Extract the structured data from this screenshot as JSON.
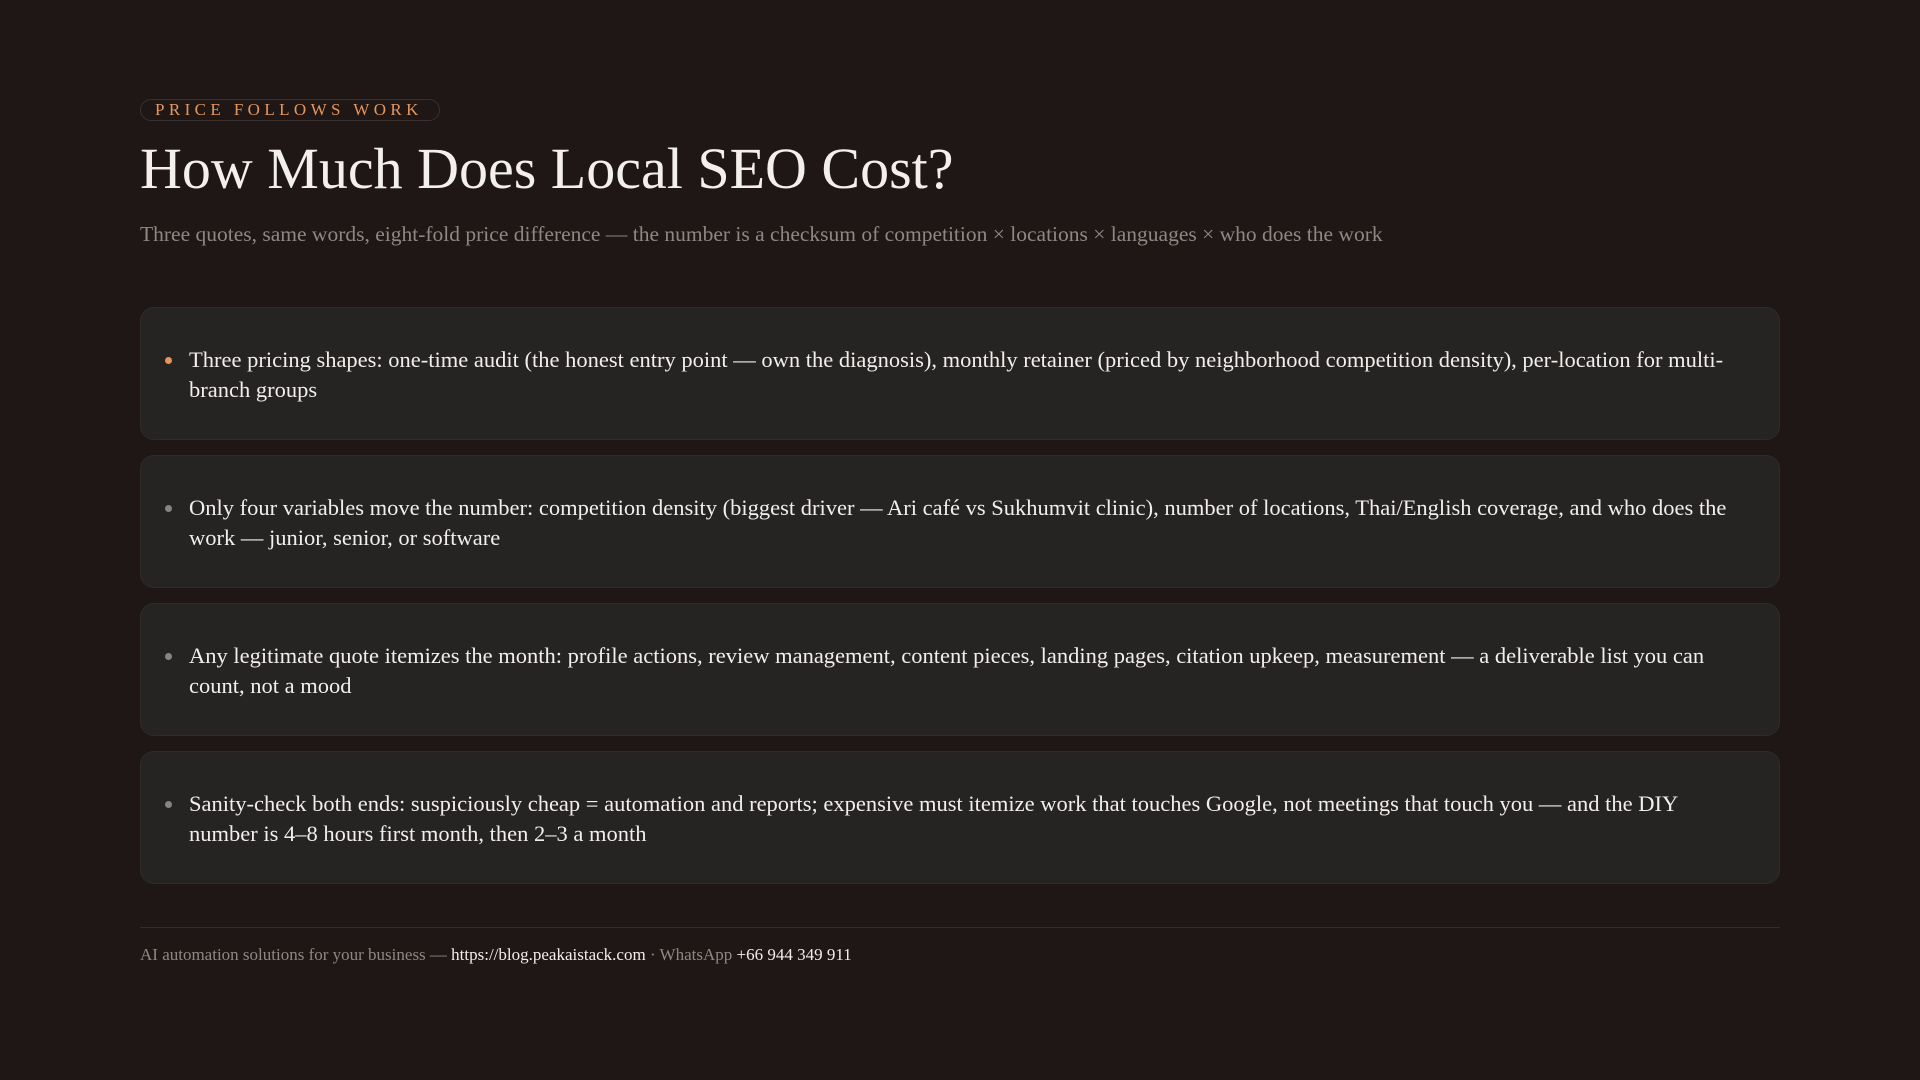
{
  "header": {
    "eyebrow": "PRICE FOLLOWS WORK",
    "title": "How Much Does Local SEO Cost?",
    "subtitle": "Three quotes, same words, eight-fold price difference — the number is a checksum of competition × locations × languages × who does the work"
  },
  "points": [
    {
      "text": "Three pricing shapes: one-time audit (the honest entry point — own the diagnosis), monthly retainer (priced by neighborhood competition density), per-location for multi-branch groups"
    },
    {
      "text": "Only four variables move the number: competition density (biggest driver — Ari café vs Sukhumvit clinic), number of locations, Thai/English coverage, and who does the work — junior, senior, or software"
    },
    {
      "text": "Any legitimate quote itemizes the month: profile actions, review management, content pieces, landing pages, citation upkeep, measurement — a deliverable list you can count, not a mood"
    },
    {
      "text": "Sanity-check both ends: suspiciously cheap = automation and reports; expensive must itemize work that touches Google, not meetings that touch you — and the DIY number is 4–8 hours first month, then 2–3 a month"
    }
  ],
  "footer": {
    "tagline": "AI automation solutions for your business — ",
    "url": "https://blog.peakaistack.com",
    "separator": " · WhatsApp ",
    "phone": "+66 944 349 911"
  },
  "colors": {
    "background": "#1e1715",
    "accent": "#e8955a",
    "card": "#262323"
  }
}
